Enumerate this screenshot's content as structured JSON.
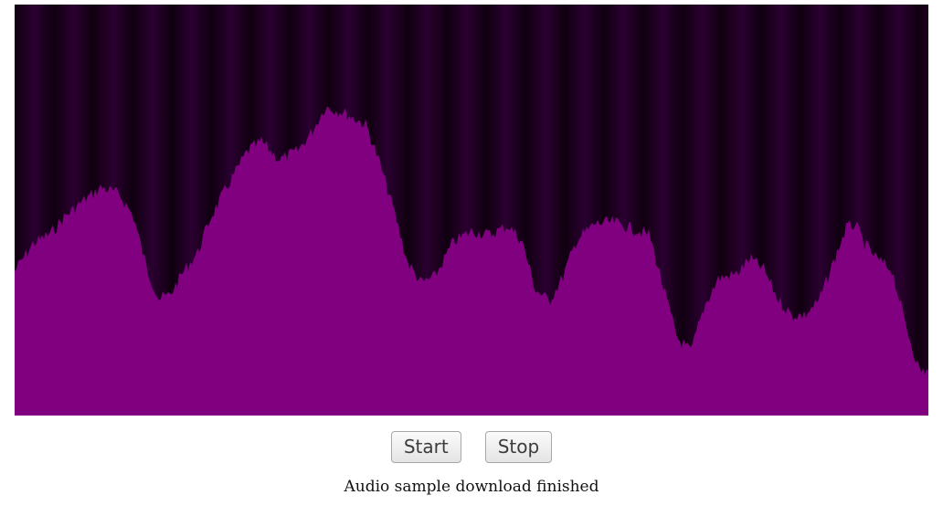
{
  "controls": {
    "start_label": "Start",
    "stop_label": "Stop"
  },
  "status": {
    "text": "Audio sample download finished"
  },
  "visualizer": {
    "fill_color": "#800080",
    "background_dark": "#100010",
    "stripe_color": "#2a0030"
  }
}
